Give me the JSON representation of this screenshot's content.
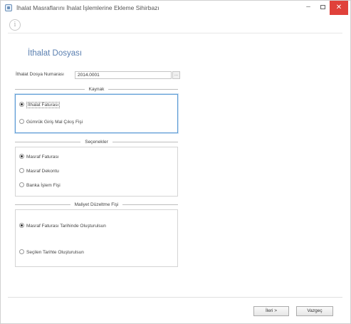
{
  "window": {
    "title": "İhalat Masraflarını İhalat İşlemlerine Ekleme Sihirbazı",
    "minimize": "–",
    "close": "✕"
  },
  "toolbar": {
    "info_icon": "i"
  },
  "page": {
    "title": "İthalat Dosyası"
  },
  "dossier": {
    "label": "İthalat Dosya Numarası",
    "value": "2014.0001",
    "browse": "..."
  },
  "groups": {
    "sources": {
      "title": "Kaynak",
      "options": [
        {
          "label": "İthalat Faturası",
          "checked": true
        },
        {
          "label": "Gümrük Giriş Mal Çıkış Fişi",
          "checked": false
        }
      ]
    },
    "expenses": {
      "title": "Seçenekler",
      "options": [
        {
          "label": "Masraf Faturası",
          "checked": true
        },
        {
          "label": "Masraf Dekontu",
          "checked": false
        },
        {
          "label": "Banka İşlem Fişi",
          "checked": false
        }
      ]
    },
    "date": {
      "title": "Maliyet Düzeltme Fişi",
      "options": [
        {
          "label": "Masraf Faturası Tarihinde Oluşturulsun",
          "checked": true
        },
        {
          "label": "Seçilen Tarihte Oluşturulsun",
          "checked": false
        }
      ]
    }
  },
  "buttons": {
    "next": "İleri >",
    "cancel": "Vazgeç"
  }
}
